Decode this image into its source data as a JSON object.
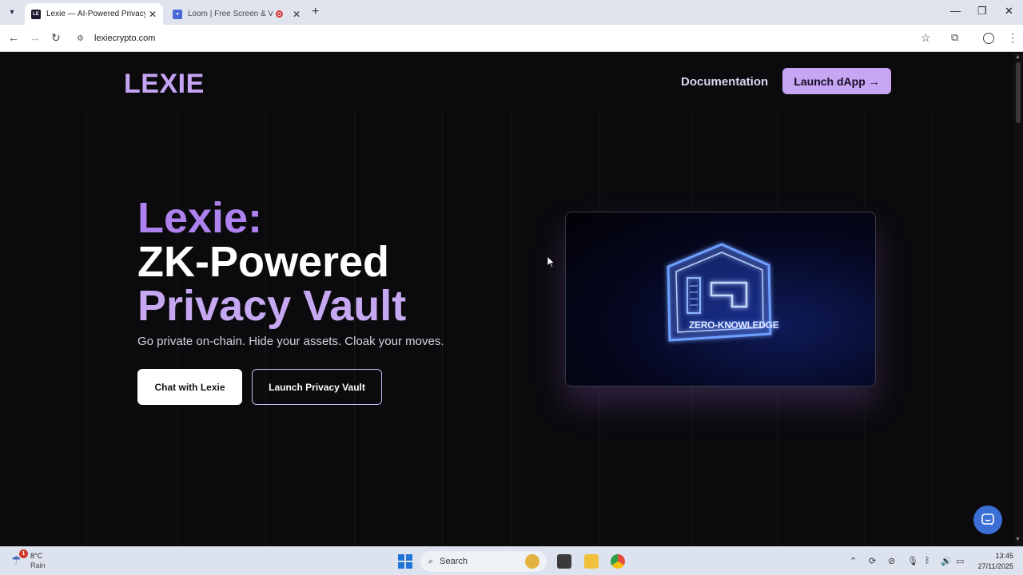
{
  "browser": {
    "tabs": [
      {
        "title": "Lexie — AI-Powered Privacy Vault",
        "active": true
      },
      {
        "title": "Loom | Free Screen & Video Recording",
        "active": false
      }
    ],
    "new_tab_symbol": "+",
    "url": "lexiecrypto.com"
  },
  "page": {
    "logo": "LEXIE",
    "nav": {
      "documentation": "Documentation",
      "launch_dapp": "Launch dApp →"
    },
    "hero": {
      "line1": "Lexie:",
      "line2": "ZK-Powered",
      "line3": "Privacy Vault",
      "tagline": "Go private on-chain. Hide your assets. Cloak your moves."
    },
    "buttons": {
      "chat": "Chat with Lexie",
      "vault": "Launch Privacy Vault"
    },
    "video": {
      "label": "ZERO-KNOWLEDGE"
    },
    "colors": {
      "brand_purple": "#c5a5f4",
      "hero_purple": "#ad82ee",
      "background": "#0b0a0d",
      "chat_widget": "#3b6fd6"
    }
  },
  "taskbar": {
    "weather": {
      "temp": "8°C",
      "desc": "Rain",
      "badge": "1"
    },
    "search_placeholder": "Search",
    "clock": {
      "time": "13:45",
      "date": "27/11/2025"
    }
  }
}
